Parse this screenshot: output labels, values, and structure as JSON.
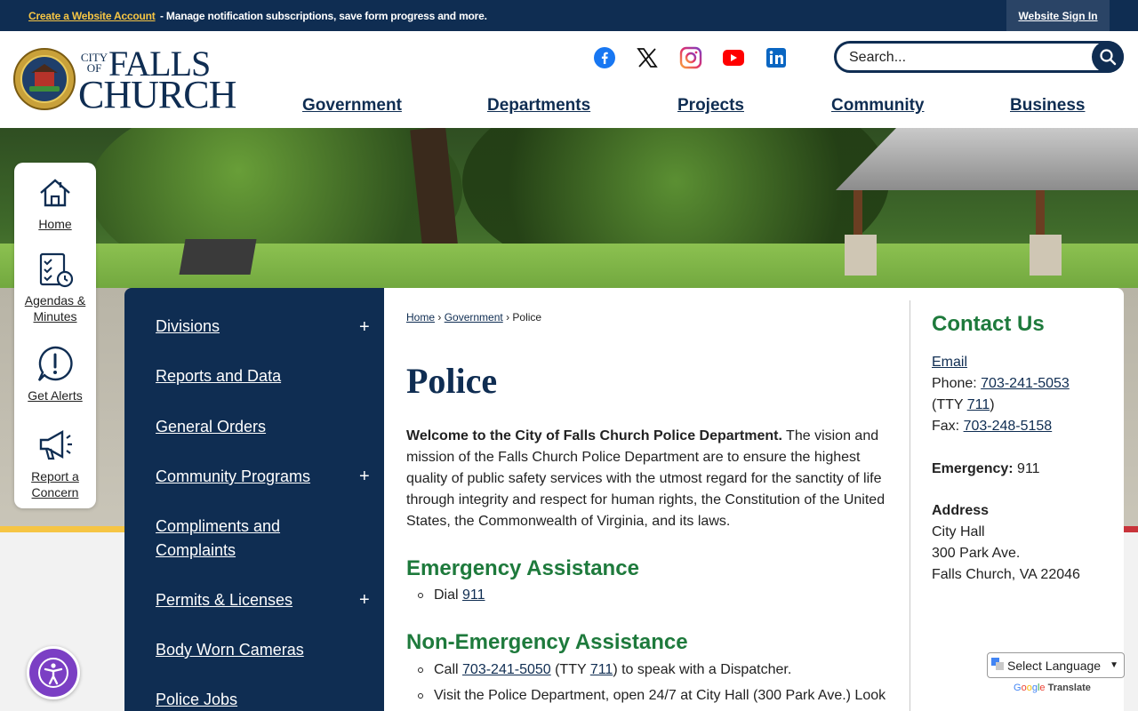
{
  "topbar": {
    "create_account": "Create a Website Account",
    "manage_text": " - Manage notification subscriptions, save form progress and more.",
    "sign_in": "Website Sign In"
  },
  "logo": {
    "city": "CITY",
    "of": "OF",
    "falls": "FALLS",
    "church": "CHURCH"
  },
  "search": {
    "placeholder": "Search..."
  },
  "main_nav": [
    "Government",
    "Departments",
    "Projects",
    "Community",
    "Business"
  ],
  "quick_links": [
    "Home",
    "Agendas & Minutes",
    "Get Alerts",
    "Report a Concern"
  ],
  "side_nav": [
    {
      "label": "Divisions",
      "expandable": true
    },
    {
      "label": "Reports and Data",
      "expandable": false
    },
    {
      "label": "General Orders",
      "expandable": false
    },
    {
      "label": "Community Programs",
      "expandable": true
    },
    {
      "label": "Compliments and Complaints",
      "expandable": false
    },
    {
      "label": "Permits & Licenses",
      "expandable": true
    },
    {
      "label": "Body Worn Cameras",
      "expandable": false
    },
    {
      "label": "Police Jobs",
      "expandable": false
    }
  ],
  "plus_symbol": "+",
  "breadcrumb": {
    "home": "Home",
    "government": "Government",
    "current": "Police",
    "separator": "›"
  },
  "page": {
    "title": "Police",
    "intro_bold": "Welcome to the City of Falls Church Police Department.",
    "intro_rest": " The vision and mission of the Falls Church Police Department are to ensure the highest quality of public safety services with the utmost regard for the sanctity of life through integrity and respect for human rights, the Constitution of the United States, the Commonwealth of Virginia, and its laws.",
    "emergency_heading": "Emergency Assistance",
    "emergency_dial": "Dial ",
    "emergency_number": "911",
    "nonemergency_heading": "Non-Emergency Assistance",
    "call_prefix": "Call ",
    "call_number": "703-241-5050",
    "call_tty_prefix": " (TTY ",
    "call_tty": "711",
    "call_suffix": ") to speak with a Dispatcher.",
    "visit_text": "Visit the Police Department, open 24/7 at City Hall (300 Park Ave.) Look"
  },
  "contact": {
    "heading": "Contact Us",
    "email": "Email",
    "phone_label": "Phone: ",
    "phone": "703-241-5053",
    "tty_prefix": "(TTY ",
    "tty": "711",
    "tty_suffix": ")",
    "fax_label": "Fax: ",
    "fax": "703-248-5158",
    "emergency_label": "Emergency:",
    "emergency_value": " 911",
    "address_label": "Address",
    "address_line1": "City Hall",
    "address_line2": "300 Park Ave.",
    "address_line3": "Falls Church, VA 22046"
  },
  "translate": {
    "select_label": "Select Language",
    "powered_by": "Translate"
  },
  "colors": {
    "navy": "#0f2d52",
    "gold": "#f6c544",
    "green": "#1e7a3c",
    "purple": "#7b3fc4"
  }
}
